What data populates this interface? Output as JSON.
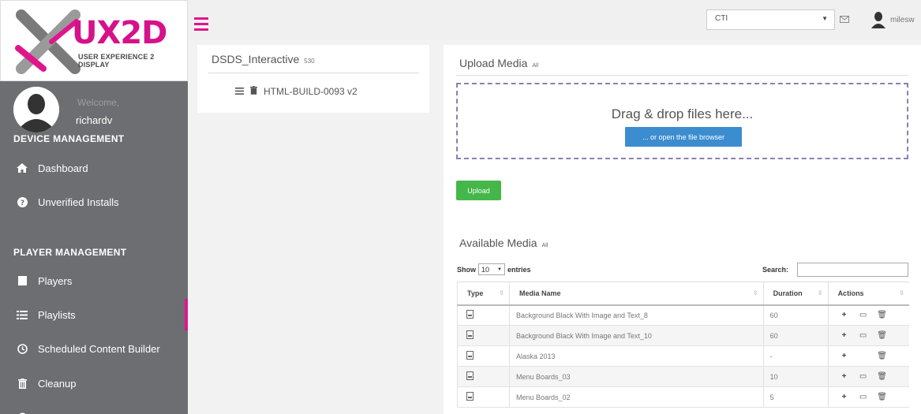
{
  "brand": {
    "logo_text": "UX2D",
    "logo_sub": "USER EXPERIENCE 2 DISPLAY",
    "accent_color": "#e0158d"
  },
  "profile": {
    "welcome": "Welcome,",
    "username": "richardv"
  },
  "sidebar": {
    "device_section": "DEVICE MANAGEMENT",
    "player_section": "PLAYER MANAGEMENT",
    "items": [
      {
        "label": "Dashboard",
        "icon": "home-icon"
      },
      {
        "label": "Unverified Installs",
        "icon": "question-circle-icon"
      },
      {
        "label": "Players",
        "icon": "square-icon"
      },
      {
        "label": "Playlists",
        "icon": "list-icon"
      },
      {
        "label": "Scheduled Content Builder",
        "icon": "clock-icon"
      },
      {
        "label": "Cleanup",
        "icon": "trash-icon"
      }
    ]
  },
  "topbar": {
    "org_value": "CTI",
    "user_name": "milesw"
  },
  "playlist": {
    "title": "DSDS_Interactive",
    "count": "530",
    "item_label": "HTML-BUILD-0093 v2"
  },
  "upload": {
    "title": "Upload Media",
    "tag": "All",
    "drop_text": "Drag & drop files here...",
    "browse_label": "... or open the file browser",
    "upload_button": "Upload"
  },
  "available": {
    "title": "Available Media",
    "tag": "All",
    "show_label": "Show",
    "entries_value": "10",
    "entries_label": "entries",
    "search_label": "Search:",
    "columns": [
      "Type",
      "Media Name",
      "Duration",
      "Actions"
    ],
    "rows": [
      {
        "name": "Background Black With Image and Text_8",
        "duration": "60",
        "has_edit": true
      },
      {
        "name": "Background Black With Image and Text_10",
        "duration": "60",
        "has_edit": true
      },
      {
        "name": "Alaska 2013",
        "duration": "-",
        "has_edit": false
      },
      {
        "name": "Menu Boards_03",
        "duration": "10",
        "has_edit": true
      },
      {
        "name": "Menu Boards_02",
        "duration": "5",
        "has_edit": true
      }
    ]
  }
}
